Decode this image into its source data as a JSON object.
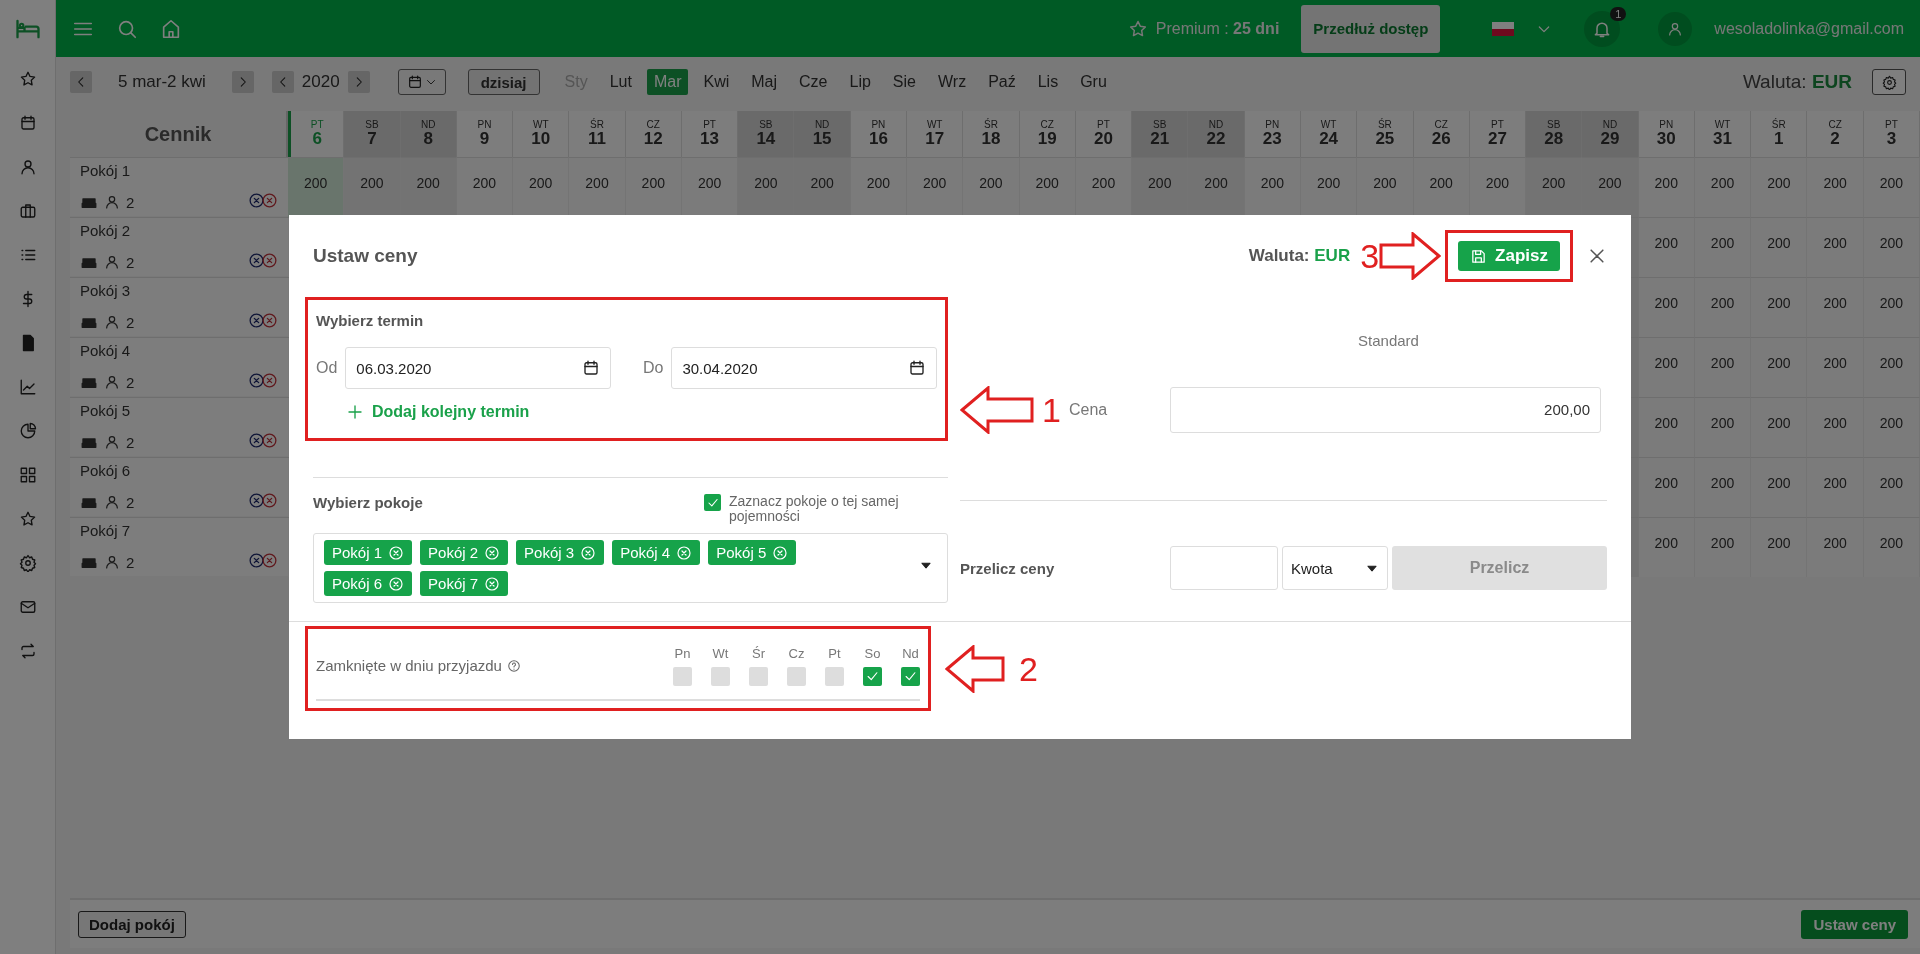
{
  "topbar": {
    "premium": "Premium : **25 dni**",
    "extend_button": "Przedłuż dostęp",
    "notifications": "1",
    "email": "wesoladolinka@gmail.com"
  },
  "toolbar": {
    "range": "5 mar-2 kwi",
    "year": "2020",
    "today_button": "dzisiaj",
    "currency_label": "Waluta:",
    "currency": "EUR",
    "months": [
      {
        "label": "Sty",
        "selected": false,
        "disabled": true
      },
      {
        "label": "Lut",
        "selected": false,
        "disabled": false
      },
      {
        "label": "Mar",
        "selected": true,
        "disabled": false
      },
      {
        "label": "Kwi",
        "selected": false,
        "disabled": false
      },
      {
        "label": "Maj",
        "selected": false,
        "disabled": false
      },
      {
        "label": "Cze",
        "selected": false,
        "disabled": false
      },
      {
        "label": "Lip",
        "selected": false,
        "disabled": false
      },
      {
        "label": "Sie",
        "selected": false,
        "disabled": false
      },
      {
        "label": "Wrz",
        "selected": false,
        "disabled": false
      },
      {
        "label": "Paź",
        "selected": false,
        "disabled": false
      },
      {
        "label": "Lis",
        "selected": false,
        "disabled": false
      },
      {
        "label": "Gru",
        "selected": false,
        "disabled": false
      }
    ]
  },
  "grid": {
    "title": "Cennik",
    "days": [
      {
        "dow": "PT",
        "day": "6",
        "weekend": false,
        "selected": true
      },
      {
        "dow": "SB",
        "day": "7",
        "weekend": true,
        "selected": false
      },
      {
        "dow": "ND",
        "day": "8",
        "weekend": true,
        "selected": false
      },
      {
        "dow": "PN",
        "day": "9",
        "weekend": false,
        "selected": false
      },
      {
        "dow": "WT",
        "day": "10",
        "weekend": false,
        "selected": false
      },
      {
        "dow": "ŚR",
        "day": "11",
        "weekend": false,
        "selected": false
      },
      {
        "dow": "CZ",
        "day": "12",
        "weekend": false,
        "selected": false
      },
      {
        "dow": "PT",
        "day": "13",
        "weekend": false,
        "selected": false
      },
      {
        "dow": "SB",
        "day": "14",
        "weekend": true,
        "selected": false
      },
      {
        "dow": "ND",
        "day": "15",
        "weekend": true,
        "selected": false
      },
      {
        "dow": "PN",
        "day": "16",
        "weekend": false,
        "selected": false
      },
      {
        "dow": "WT",
        "day": "17",
        "weekend": false,
        "selected": false
      },
      {
        "dow": "ŚR",
        "day": "18",
        "weekend": false,
        "selected": false
      },
      {
        "dow": "CZ",
        "day": "19",
        "weekend": false,
        "selected": false
      },
      {
        "dow": "PT",
        "day": "20",
        "weekend": false,
        "selected": false
      },
      {
        "dow": "SB",
        "day": "21",
        "weekend": true,
        "selected": false
      },
      {
        "dow": "ND",
        "day": "22",
        "weekend": true,
        "selected": false
      },
      {
        "dow": "PN",
        "day": "23",
        "weekend": false,
        "selected": false
      },
      {
        "dow": "WT",
        "day": "24",
        "weekend": false,
        "selected": false
      },
      {
        "dow": "ŚR",
        "day": "25",
        "weekend": false,
        "selected": false
      },
      {
        "dow": "CZ",
        "day": "26",
        "weekend": false,
        "selected": false
      },
      {
        "dow": "PT",
        "day": "27",
        "weekend": false,
        "selected": false
      },
      {
        "dow": "SB",
        "day": "28",
        "weekend": true,
        "selected": false
      },
      {
        "dow": "ND",
        "day": "29",
        "weekend": true,
        "selected": false
      },
      {
        "dow": "PN",
        "day": "30",
        "weekend": false,
        "selected": false
      },
      {
        "dow": "WT",
        "day": "31",
        "weekend": false,
        "selected": false
      },
      {
        "dow": "ŚR",
        "day": "1",
        "weekend": false,
        "selected": false
      },
      {
        "dow": "CZ",
        "day": "2",
        "weekend": false,
        "selected": false
      },
      {
        "dow": "PT",
        "day": "3",
        "weekend": false,
        "selected": false
      }
    ],
    "rooms": [
      {
        "name": "Pokój 1",
        "capacity": "2",
        "prices": [
          "200",
          "200",
          "200",
          "200",
          "200",
          "200",
          "200",
          "200",
          "200",
          "200",
          "200",
          "200",
          "200",
          "200",
          "200",
          "200",
          "200",
          "200",
          "200",
          "200",
          "200",
          "200",
          "200",
          "200",
          "200",
          "200",
          "200",
          "200",
          "200"
        ]
      },
      {
        "name": "Pokój 2",
        "capacity": "2",
        "prices": [
          "200",
          "200",
          "200",
          "200",
          "200"
        ]
      },
      {
        "name": "Pokój 3",
        "capacity": "2",
        "prices": [
          "200",
          "200",
          "200",
          "200",
          "200"
        ]
      },
      {
        "name": "Pokój 4",
        "capacity": "2",
        "prices": [
          "200",
          "200",
          "200",
          "200",
          "200"
        ]
      },
      {
        "name": "Pokój 5",
        "capacity": "2",
        "prices": [
          "200",
          "200",
          "200",
          "200",
          "200"
        ]
      },
      {
        "name": "Pokój 6",
        "capacity": "2",
        "prices": [
          "200",
          "200",
          "200",
          "200",
          "200"
        ]
      },
      {
        "name": "Pokój 7",
        "capacity": "2",
        "prices": [
          "200",
          "200",
          "200",
          "200",
          "200"
        ]
      }
    ]
  },
  "footer": {
    "add_room": "Dodaj pokój",
    "set_prices": "Ustaw ceny"
  },
  "modal": {
    "title": "Ustaw ceny",
    "currency_label": "Waluta:",
    "currency": "EUR",
    "save_button": "Zapisz",
    "period": {
      "heading": "Wybierz termin",
      "from_label": "Od",
      "from": "06.03.2020",
      "to_label": "Do",
      "to": "30.04.2020",
      "add_link": "Dodaj kolejny termin"
    },
    "rooms_section": {
      "heading": "Wybierz pokoje",
      "same_capacity": {
        "label": "Zaznacz pokoje o tej samej pojemności",
        "checked": true
      },
      "tags": [
        "Pokój 1",
        "Pokój 2",
        "Pokój 3",
        "Pokój 4",
        "Pokój 5",
        "Pokój 6",
        "Pokój 7"
      ]
    },
    "price": {
      "column": "Standard",
      "label": "Cena",
      "value": "200,00"
    },
    "recalc": {
      "label": "Przelicz ceny",
      "mode": "Kwota",
      "button": "Przelicz",
      "disabled": true
    },
    "closed_arrival": {
      "label": "Zamknięte w dniu przyjazdu",
      "days": [
        {
          "label": "Pn",
          "checked": false
        },
        {
          "label": "Wt",
          "checked": false
        },
        {
          "label": "Śr",
          "checked": false
        },
        {
          "label": "Cz",
          "checked": false
        },
        {
          "label": "Pt",
          "checked": false
        },
        {
          "label": "So",
          "checked": true
        },
        {
          "label": "Nd",
          "checked": true
        }
      ]
    }
  },
  "annotations": [
    "1",
    "2",
    "3"
  ]
}
